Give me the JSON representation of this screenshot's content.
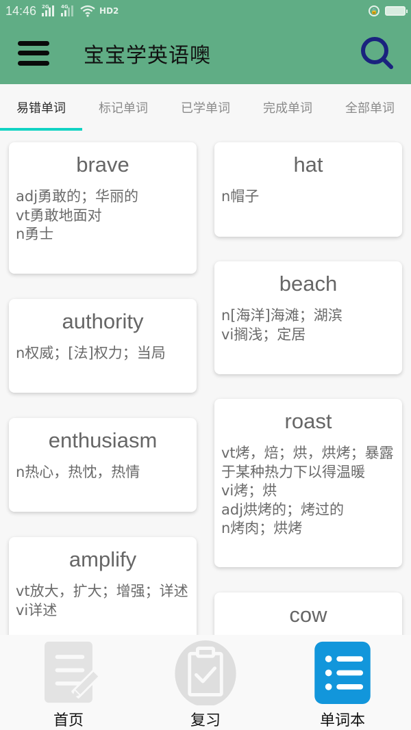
{
  "status_bar": {
    "time": "14:46",
    "signal_1_label": "2G",
    "signal_2_label": "4G",
    "hd_label": "HD2"
  },
  "app_bar": {
    "title": "宝宝学英语噢",
    "menu_icon": "hamburger-menu-icon",
    "search_icon": "search-icon"
  },
  "colors": {
    "primary": "#60ad85",
    "tab_indicator": "#12d3c3",
    "search_icon": "#1a237e",
    "active_nav": "#1296db",
    "inactive_nav": "#e0e0e0"
  },
  "tabs": [
    {
      "label": "易错单词",
      "active": true
    },
    {
      "label": "标记单词",
      "active": false
    },
    {
      "label": "已学单词",
      "active": false
    },
    {
      "label": "完成单词",
      "active": false
    },
    {
      "label": "全部单词",
      "active": false
    }
  ],
  "cards": [
    {
      "word": "brave",
      "definitions": "adj勇敢的；华丽的\nvt勇敢地面对\nn勇士"
    },
    {
      "word": "hat",
      "definitions": "n帽子"
    },
    {
      "word": "authority",
      "definitions": "n权威；[法]权力；当局"
    },
    {
      "word": "beach",
      "definitions": "n[海洋]海滩；湖滨\nvi搁浅；定居"
    },
    {
      "word": "enthusiasm",
      "definitions": "n热心，热忱，热情"
    },
    {
      "word": "roast",
      "definitions": "vt烤，焙；烘，烘烤；暴露于某种热力下以得温暖\nvi烤；烘\nadj烘烤的；烤过的\nn烤肉；烘烤"
    },
    {
      "word": "amplify",
      "definitions": "vt放大，扩大；增强；详述\nvi详述"
    },
    {
      "word": "cow",
      "definitions": ""
    }
  ],
  "bottom_nav": [
    {
      "label": "首页",
      "icon": "document-edit-icon",
      "active": false
    },
    {
      "label": "复习",
      "icon": "clipboard-check-icon",
      "active": false
    },
    {
      "label": "单词本",
      "icon": "list-icon",
      "active": true
    }
  ]
}
